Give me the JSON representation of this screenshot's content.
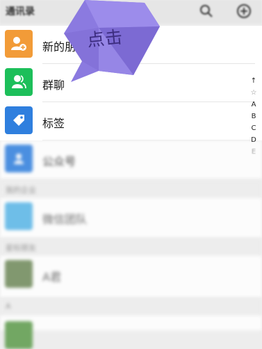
{
  "header": {
    "title": "通讯录"
  },
  "rows": [
    {
      "label": "新的朋友",
      "icon": "add-friend-icon",
      "color": "#f29b38"
    },
    {
      "label": "群聊",
      "icon": "group-chat-icon",
      "color": "#1dbf5a"
    },
    {
      "label": "标签",
      "icon": "tag-icon",
      "color": "#2f7fde"
    },
    {
      "label": "公众号",
      "icon": "official-account-icon",
      "color": "#2f7fde"
    }
  ],
  "sections": [
    "我的企业",
    "星标朋友",
    "A"
  ],
  "contacts": [
    {
      "name": "微信团队"
    },
    {
      "name": "A君"
    }
  ],
  "alpha_index": [
    "↑",
    "☆",
    "A",
    "B",
    "C",
    "D",
    "E"
  ],
  "bubble": {
    "text": "点击",
    "color": "#8b7ae0"
  }
}
